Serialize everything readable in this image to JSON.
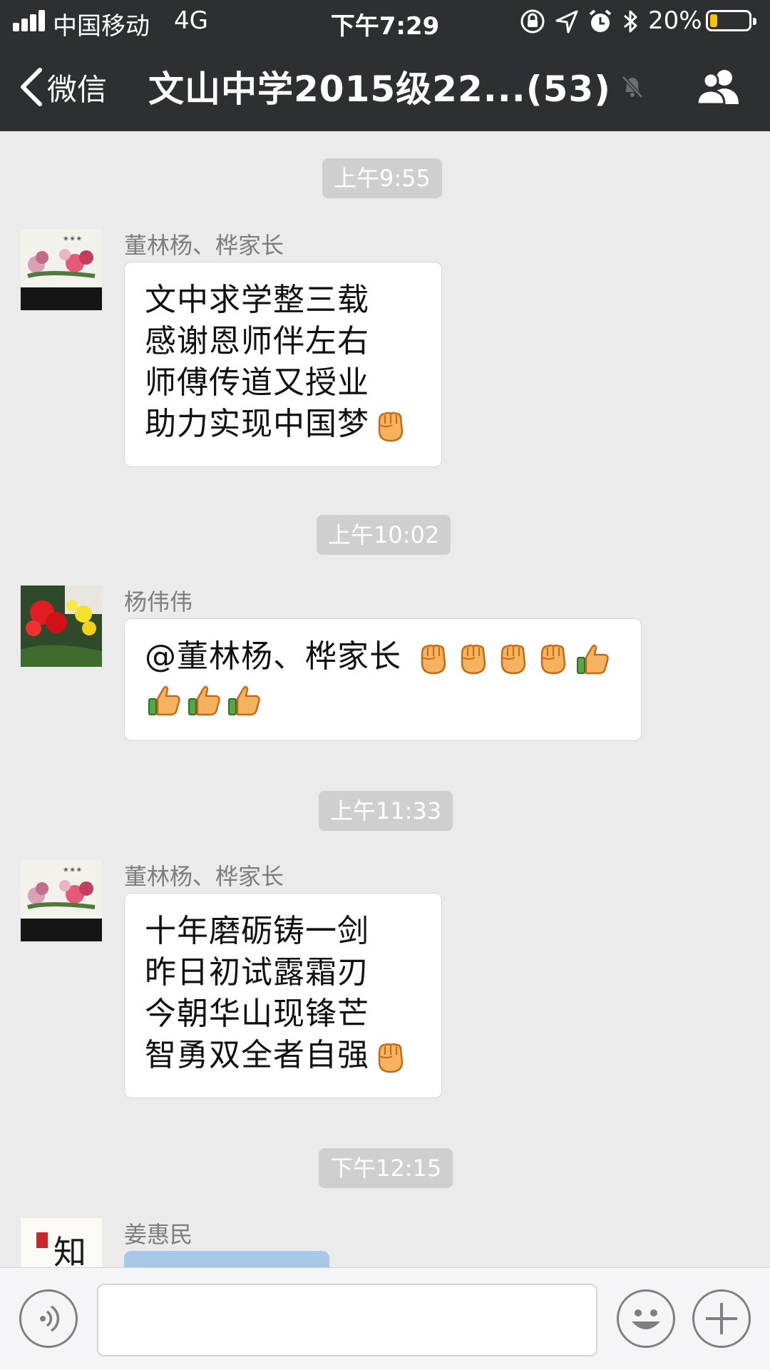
{
  "status_bar": {
    "carrier": "中国移动",
    "network": "4G",
    "time": "下午7:29",
    "battery_percent": "20%",
    "battery_level": 0.2,
    "icons": [
      "signal-icon",
      "orientation-lock-icon",
      "location-icon",
      "alarm-icon",
      "bluetooth-icon",
      "battery-icon"
    ]
  },
  "nav": {
    "back_label": "微信",
    "title": "文山中学2015级22...(53)",
    "icons": [
      "back-chevron-icon",
      "mute-bell-icon",
      "group-members-icon"
    ]
  },
  "messages": [
    {
      "time": "上午9:55",
      "sender": "董林杨、桦家长",
      "avatar": "peony-painting-avatar",
      "lines": [
        "文中求学整三载",
        "感谢恩师伴左右",
        "师傅传道又授业",
        "助力实现中国梦"
      ],
      "emoji": [
        "fist-emoji"
      ]
    },
    {
      "time": "上午10:02",
      "sender": "杨伟伟",
      "avatar": "flowers-avatar",
      "lines": [
        "@董林杨、桦家长 "
      ],
      "emoji": [
        "fist-emoji",
        "fist-emoji",
        "fist-emoji",
        "fist-emoji",
        "thumbs-up-emoji",
        "thumbs-up-emoji",
        "thumbs-up-emoji",
        "thumbs-up-emoji"
      ]
    },
    {
      "time": "上午11:33",
      "sender": "董林杨、桦家长",
      "avatar": "peony-painting-avatar",
      "lines": [
        "十年磨砺铸一剑",
        "昨日初试露霜刃",
        "今朝华山现锋芒",
        "智勇双全者自强"
      ],
      "emoji": [
        "fist-emoji"
      ]
    },
    {
      "time": "下午12:15",
      "sender": "姜惠民",
      "avatar": "calligraphy-avatar",
      "avatar_text": "知",
      "content": "link-card"
    }
  ],
  "input_bar": {
    "icons": [
      "voice-icon",
      "emoji-icon",
      "plus-icon"
    ],
    "text_value": ""
  },
  "colors": {
    "nav_bg": "#2e2f33",
    "chat_bg": "#ebebeb",
    "time_pill": "#cfcfcf",
    "battery_fill": "#f7c600"
  }
}
